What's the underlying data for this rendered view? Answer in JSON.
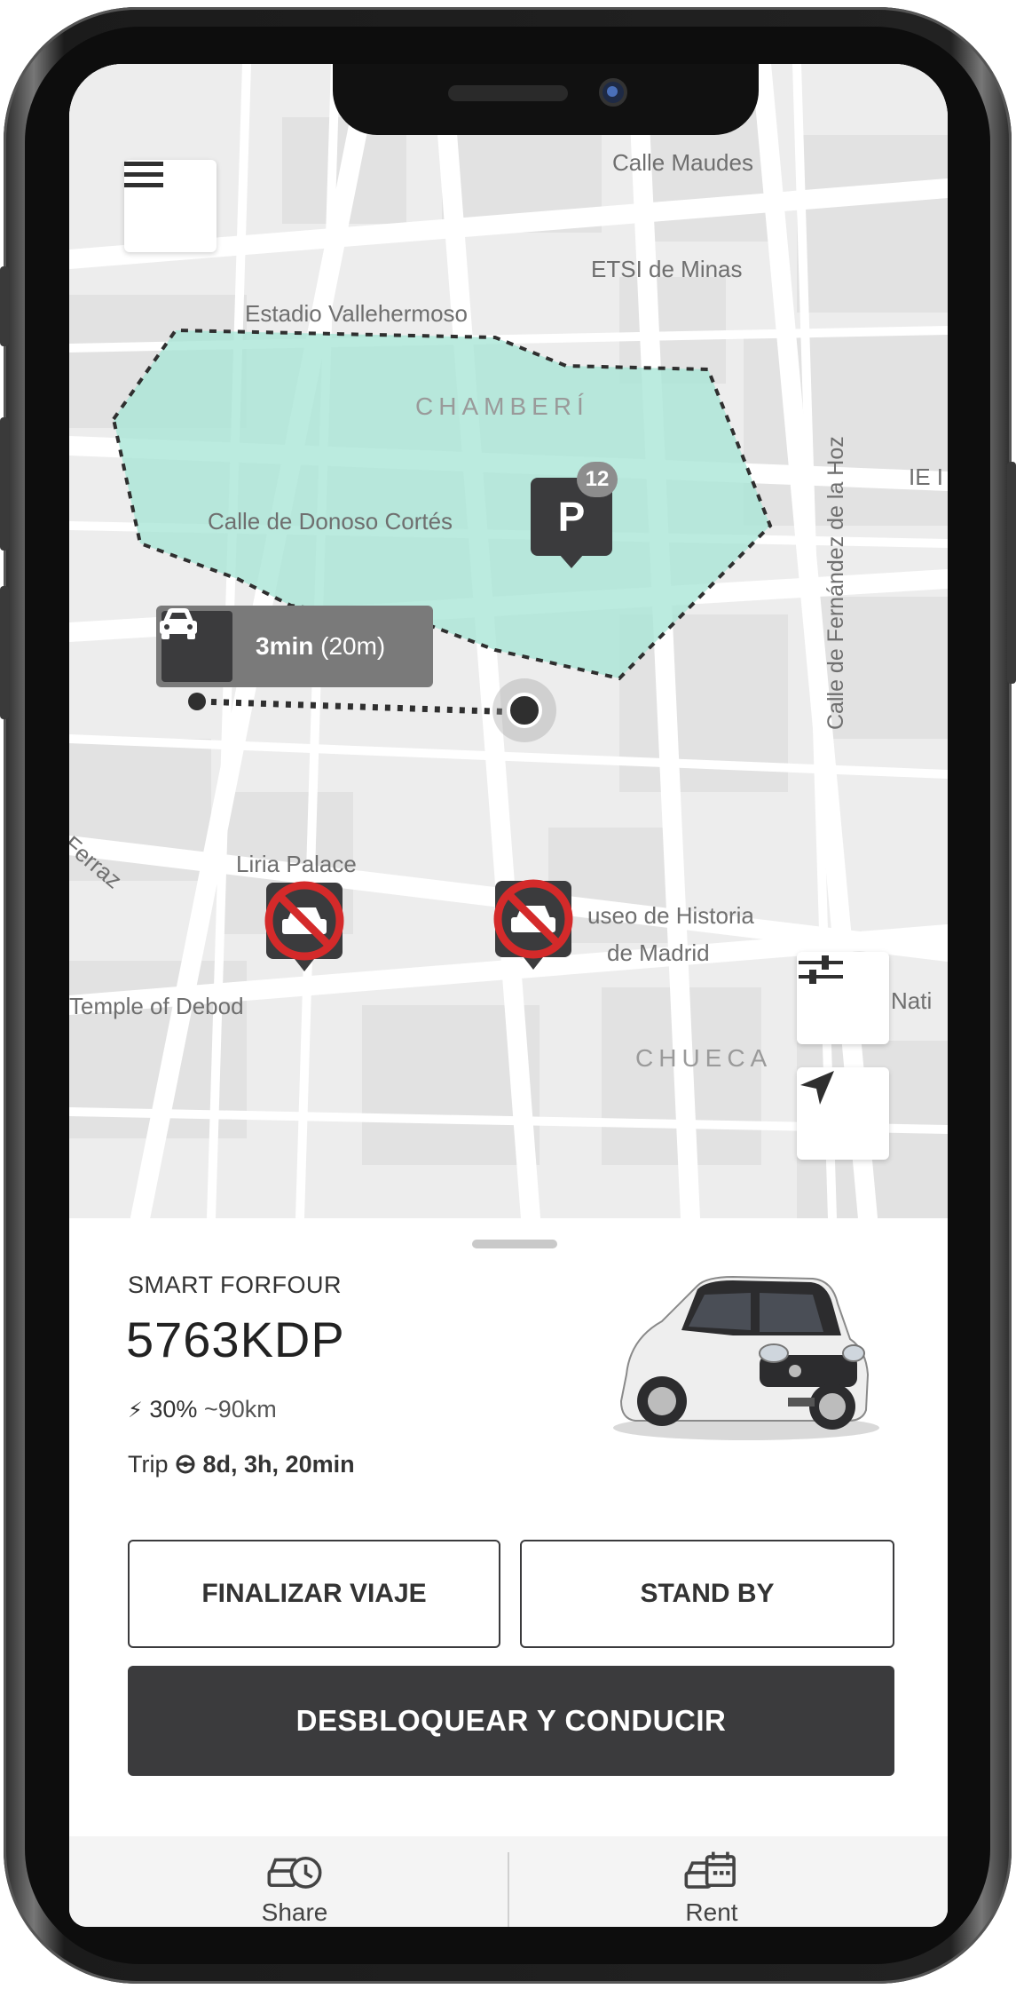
{
  "map": {
    "labels": {
      "calle_maudes": "Calle Maudes",
      "etsi_minas": "ETSI de Minas",
      "estadio": "Estadio Vallehermoso",
      "chamberi": "CHAMBERÍ",
      "donoso": "Calle de Donoso Cortés",
      "fernandez": "Calle de Fernández de la Hoz",
      "ie": "IE I",
      "ferraz": "de Ferraz",
      "liria": "Liria Palace",
      "museo": "useo de Historia",
      "museo2": "de Madrid",
      "debod": "Temple of Debod",
      "chueca": "CHUECA",
      "nati": "Nati"
    },
    "eta": {
      "time": "3min",
      "distance": "(20m)"
    },
    "parking": {
      "letter": "P",
      "count": "12"
    },
    "zone_color": "#a8e6d6",
    "icons": [
      "menu-icon",
      "car-icon",
      "no-car-icon",
      "filters-icon",
      "locate-arrow-icon"
    ]
  },
  "vehicle": {
    "model": "SMART FORFOUR",
    "plate": "5763KDP",
    "battery_percent": "30%",
    "range": "~90km",
    "trip_label": "Trip",
    "trip_duration": "8d, 3h, 20min"
  },
  "actions": {
    "finish": "FINALIZAR VIAJE",
    "standby": "STAND BY",
    "unlock": "DESBLOQUEAR Y CONDUCIR"
  },
  "tabs": [
    {
      "label": "Share",
      "icon": "car-clock-icon"
    },
    {
      "label": "Rent",
      "icon": "car-calendar-icon"
    }
  ],
  "colors": {
    "dark": "#3b3b3d",
    "accent_red": "#d42a2a"
  }
}
